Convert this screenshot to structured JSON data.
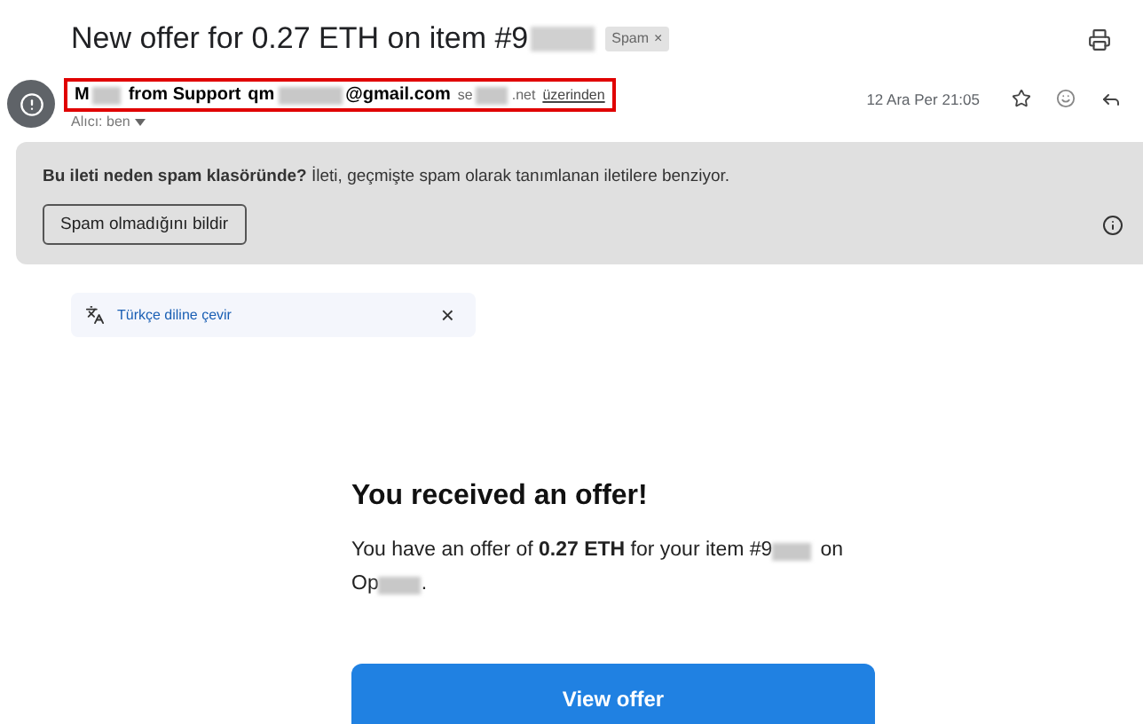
{
  "subject": {
    "text_start": "New offer for 0.27 ETH on item #9",
    "label": "Spam",
    "label_close": "×"
  },
  "sender": {
    "name_start": "M",
    "name_end": "from Support",
    "email_start": "qm",
    "email_end": "@gmail.com",
    "via_start": "se",
    "via_end": ".net",
    "via_link": "üzerinden",
    "recipient": "Alıcı: ben",
    "date": "12 Ara Per 21:05",
    "highlighted": true
  },
  "spam_banner": {
    "text": "**Bu ileti neden spam klasöründe?** İleti, geçmişte spam olarak tanımlanan iletilere benziyor.",
    "button": "Spam olmadığını bildir"
  },
  "translate": {
    "link": "Türkçe diline çevir",
    "close": "×"
  },
  "message": {
    "heading": "You received an offer!",
    "body_start": "You have an offer of **0.27 ETH** for your item #9",
    "body_mid": "on",
    "body_line2_start": "Op",
    "body_line2_end": ".",
    "button": "View offer"
  }
}
